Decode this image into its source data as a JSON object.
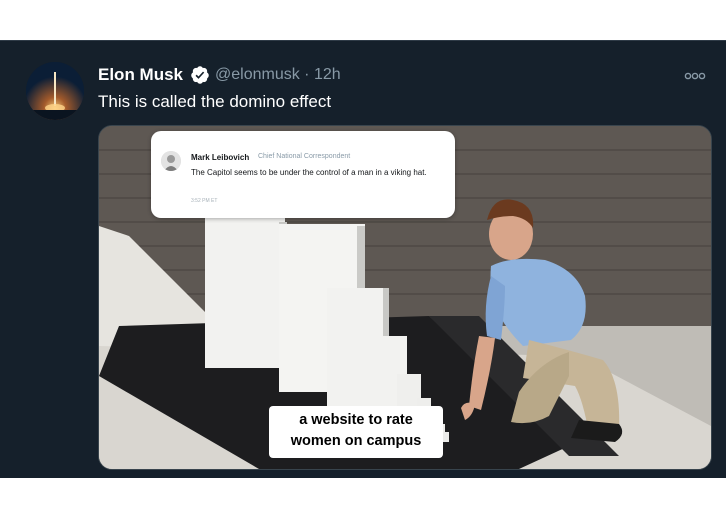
{
  "tweet": {
    "author_name": "Elon Musk",
    "handle": "@elonmusk",
    "separator": "·",
    "time": "12h",
    "text": "This is called the domino effect",
    "more_icon": "more-options-icon",
    "verified_icon": "verified-badge-icon",
    "colors": {
      "background": "#15202b",
      "secondary_text": "#8899a6",
      "verified": "#ffffff"
    }
  },
  "meme": {
    "embedded_tweet": {
      "author_name": "Mark Leibovich",
      "author_title": "Chief National Correspondent",
      "text": "The Capitol seems to be under the control of a man in a viking hat.",
      "time": "3:52 PM ET"
    },
    "caption_line1": "a website to rate",
    "caption_line2": "women on campus"
  }
}
